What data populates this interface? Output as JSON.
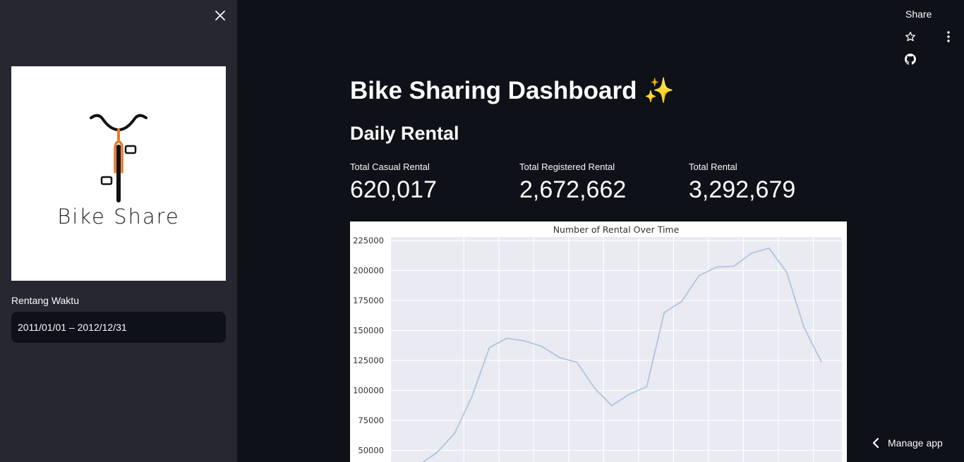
{
  "sidebar": {
    "logo_text": "Bike Share",
    "date_range_label": "Rentang Waktu",
    "date_range_value": "2011/01/01 – 2012/12/31"
  },
  "toolbar": {
    "share_label": "Share"
  },
  "main": {
    "title": "Bike Sharing Dashboard ✨",
    "section_title": "Daily Rental",
    "metrics": [
      {
        "label": "Total Casual Rental",
        "value": "620,017"
      },
      {
        "label": "Total Registered Rental",
        "value": "2,672,662"
      },
      {
        "label": "Total Rental",
        "value": "3,292,679"
      }
    ]
  },
  "footer": {
    "manage_app_label": "Manage app"
  },
  "colors": {
    "app_bg": "#0e1117",
    "sidebar_bg": "#262730",
    "plot_bg": "#eaeaf2",
    "line": "#b0c4de",
    "logo_orange": "#e8792b"
  },
  "chart_data": {
    "type": "line",
    "title": "Number of Rental Over Time",
    "xlabel": "",
    "ylabel": "",
    "yticks": [
      50000,
      75000,
      100000,
      125000,
      150000,
      175000,
      200000,
      225000
    ],
    "ylim": [
      40000,
      230000
    ],
    "grid": true,
    "x_count": 24,
    "series": [
      {
        "values": [
          38189,
          48215,
          64045,
          94870,
          135821,
          143512,
          141341,
          136691,
          127418,
          123511,
          102167,
          87323,
          96744,
          103137,
          164875,
          174224,
          195865,
          202830,
          203607,
          214503,
          218573,
          198841,
          152664,
          123713
        ]
      }
    ]
  }
}
